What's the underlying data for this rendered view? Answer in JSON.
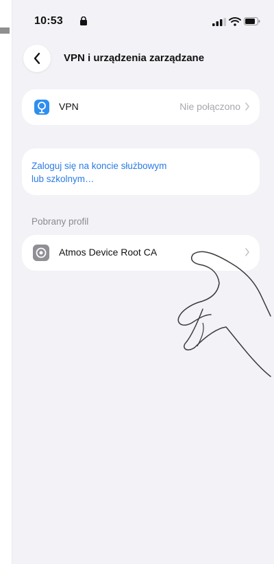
{
  "status_bar": {
    "time": "10:53"
  },
  "nav": {
    "title": "VPN i urządzenia zarządzane"
  },
  "vpn_row": {
    "label": "VPN",
    "value": "Nie połączono"
  },
  "work_account": {
    "link_text_line1": "Zaloguj się na koncie służbowym",
    "link_text_line2": "lub szkolnym…"
  },
  "downloaded_profile": {
    "section_title": "Pobrany profil",
    "label": "Atmos Device Root CA"
  },
  "colors": {
    "link": "#2a7be4",
    "vpn_icon": "#2f8ef0",
    "background": "#f2f2f7"
  }
}
